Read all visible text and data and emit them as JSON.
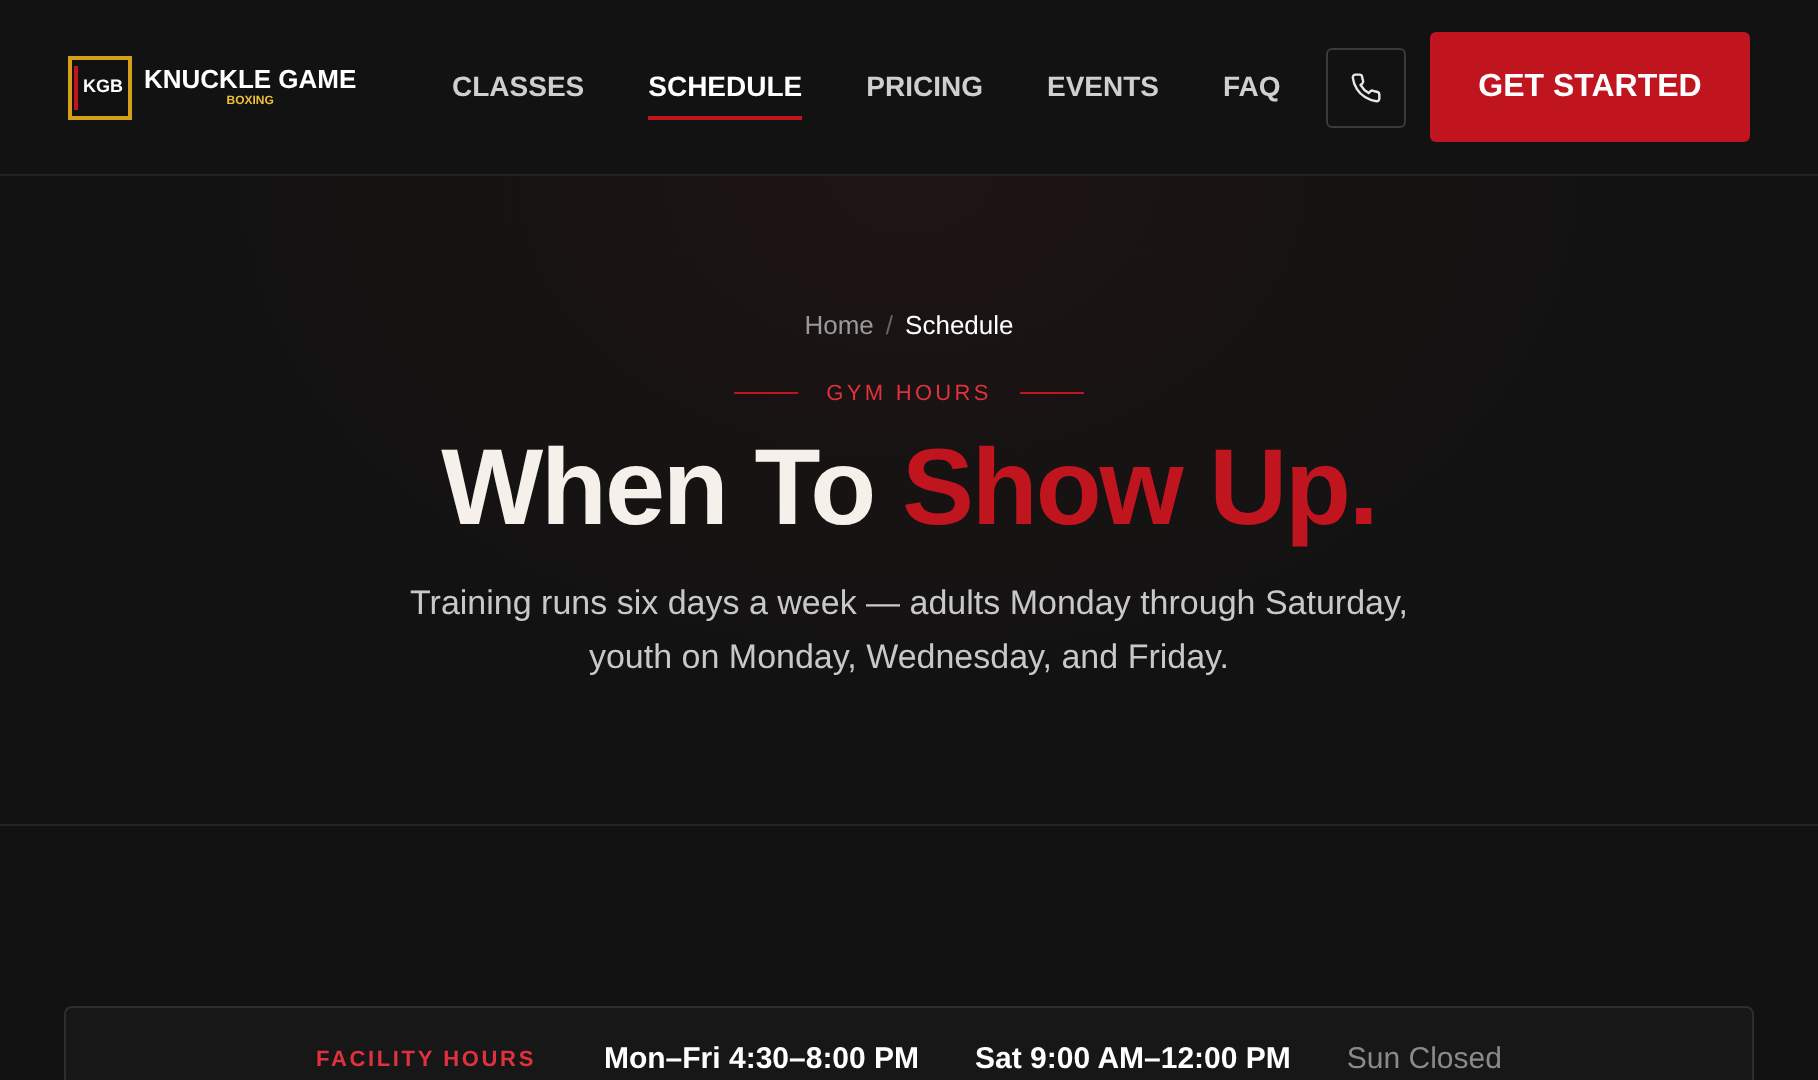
{
  "logo": {
    "mark": "KGB",
    "name": "KNUCKLE GAME",
    "tagline": "BOXING"
  },
  "nav": [
    {
      "label": "CLASSES",
      "selected": false
    },
    {
      "label": "SCHEDULE",
      "selected": true
    },
    {
      "label": "PRICING",
      "selected": false
    },
    {
      "label": "EVENTS",
      "selected": false
    },
    {
      "label": "FAQ",
      "selected": false
    }
  ],
  "cta": "GET STARTED",
  "breadcrumb": [
    "Home",
    "Schedule"
  ],
  "breadcrumb_separator": "/",
  "eyebrow": "GYM HOURS",
  "heading": {
    "plain": "When To",
    "accent": "Show Up."
  },
  "intro": "Training runs six days a week — adults Monday through Saturday, youth on Monday, Wednesday, and Friday.",
  "facility_hours": {
    "label": "FACILITY HOURS",
    "items": [
      {
        "text": "Mon–Fri 4:30–8:00 PM",
        "closed": false
      },
      {
        "text": "Sat 9:00 AM–12:00 PM",
        "closed": false
      },
      {
        "text": "Sun Closed",
        "closed": true
      }
    ]
  }
}
